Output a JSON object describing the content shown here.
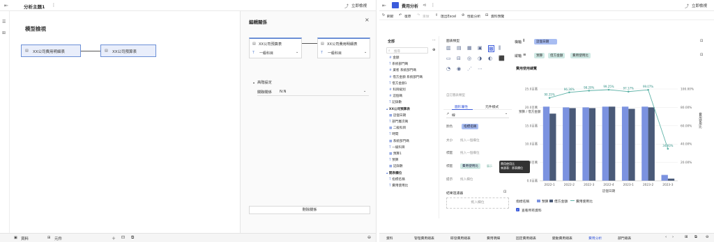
{
  "left": {
    "topbar": {
      "title": "分析主題1",
      "more": "⋮",
      "share_label": "立即檢視"
    },
    "model": {
      "title": "模型檢視",
      "table_a": "XX公司費用明細表",
      "table_b": "XX公司預算表"
    },
    "editor": {
      "title": "編輯關係",
      "close": "×",
      "card_a_title": "XX公司預算表",
      "card_a_field": "一級科目",
      "card_b_title": "XX公司費用明細表",
      "card_b_field": "一級科目",
      "advanced": "高階設定",
      "relation_label": "關聯關係",
      "relation_value": "N:N",
      "delete_button": "刪除關係"
    },
    "bottom": {
      "tab_data": "資料",
      "tab_component": "元件"
    }
  },
  "right": {
    "topbar": {
      "title": "費用分析",
      "share_label": "立即檢視"
    },
    "toolbar": {
      "refresh": "刷新",
      "undo": "復原",
      "redo": "重做",
      "export": "匯出Excel",
      "perf": "性能分析",
      "detail": "資料預覽"
    },
    "datapanel": {
      "tab": "全部",
      "tab_right": "⋯",
      "search": "搜尋",
      "fields_a": [
        "金額",
        "系統部門碼",
        "業者 系統部門碼",
        "借方金額 系統部門碼",
        "借方金額1",
        "科目級別",
        "這個碼",
        "記錄數"
      ],
      "group_b": "XX公司預算表",
      "fields_b": [
        "這個日期",
        "部門層次碼",
        "二級科目",
        "時間",
        "系統部門碼",
        "一級科目",
        "預算1",
        "預算",
        "記錄數"
      ],
      "group_c": "開表欄位",
      "fields_c": [
        "指標名稱",
        "費用使用比"
      ]
    },
    "config": {
      "chart_types_label": "圖表類型",
      "auto_label": "自訂圖表類型",
      "tab_graph": "圖形屬性",
      "tab_component": "元件樣式",
      "style_value": "線",
      "color_label": "顏色",
      "color_chip": "指標名稱",
      "size_label": "大小",
      "size_placeholder": "拖入一個欄位",
      "label_label": "標籤",
      "label_placeholder": "拖入一個欄位",
      "tooltip_label": "標籤",
      "tooltip_chip": "費用使用比",
      "tooltip_chip_right": "展示",
      "popup_line1": "費用使用比",
      "popup_line2": "來源表：原表欄位",
      "detail_label": "提示",
      "detail_placeholder": "拖入欄位",
      "filter_label": "結果過濾器",
      "filter_placeholder": "拖入欄位"
    },
    "axes": {
      "vertical_label": "橫軸",
      "vertical_chip": "這個日期",
      "horizontal_label": "縱軸",
      "chips": [
        "預算",
        "借方金額",
        "費用使用比"
      ]
    },
    "legend": {
      "name": "指標名稱",
      "items": [
        "預算",
        "借方金額",
        "費用使用比"
      ],
      "checkbox": "查看所有資料"
    },
    "bottom": {
      "tabs": [
        "資料",
        "管理費用總表",
        "研發費用總表",
        "費用明細",
        "固定費用總表",
        "變動費用總表",
        "費用分析",
        "部門總表"
      ]
    }
  },
  "chart_data": {
    "type": "bar",
    "title": "費用使用總覽",
    "categories": [
      "2022-1",
      "2022-2",
      "2022-3",
      "2022-4",
      "2023-1",
      "2023-2",
      "2023-3"
    ],
    "xlabel": "這個日期",
    "ylabel": "預算 / 借方金額",
    "y2label": "費用使用比",
    "series": [
      {
        "name": "預算",
        "values": [
          20.2,
          20.0,
          20.0,
          20.2,
          20.2,
          20.2,
          1.6
        ]
      },
      {
        "name": "借方金額",
        "values": [
          18.3,
          19.8,
          19.8,
          20.2,
          19.6,
          20.0,
          0.6
        ]
      },
      {
        "name": "費用使用比",
        "values": [
          90.35,
          96.36,
          98.2,
          99.25,
          97.17,
          99.07,
          34.93
        ]
      }
    ],
    "ylim": [
      0,
      25
    ],
    "y2lim": [
      0,
      100
    ],
    "yticks": [
      "0.0百萬",
      "5.0百萬",
      "10.0百萬",
      "15.0百萬",
      "20.0百萬",
      "25.0百萬"
    ],
    "y2ticks": [
      "20.00%",
      "40.00%",
      "60.00%",
      "80.00%",
      "100.00%"
    ],
    "line_labels": [
      "90.35%",
      "96.36%",
      "98.20%",
      "99.25%",
      "97.17%",
      "99.07%",
      "34.93%"
    ],
    "colors": {
      "budget": "#7b92e0",
      "debit": "#4a5a78",
      "ratio": "#5fb3a8"
    }
  }
}
